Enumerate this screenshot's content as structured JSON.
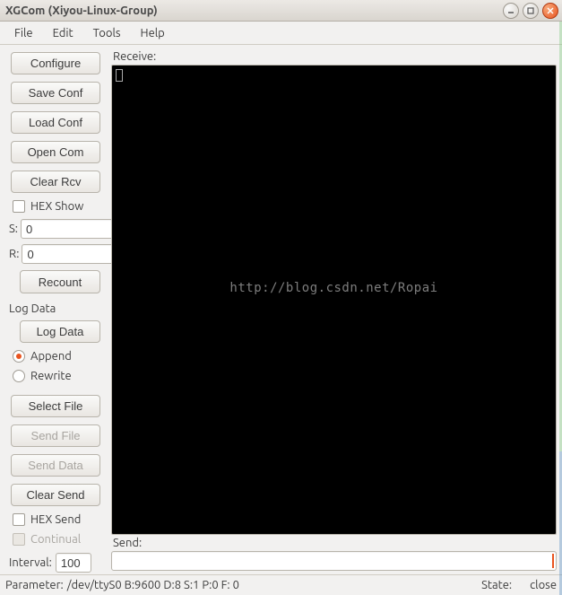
{
  "window": {
    "title": "XGCom (Xiyou-Linux-Group)"
  },
  "menu": {
    "file": "File",
    "edit": "Edit",
    "tools": "Tools",
    "help": "Help"
  },
  "sidebar": {
    "configure": "Configure",
    "save_conf": "Save Conf",
    "load_conf": "Load Conf",
    "open_com": "Open Com",
    "clear_rcv": "Clear Rcv",
    "hex_show": "HEX Show",
    "s_label": "S:",
    "s_value": "0",
    "r_label": "R:",
    "r_value": "0",
    "recount": "Recount",
    "log_data_section": "Log Data",
    "log_data_btn": "Log Data",
    "append": "Append",
    "rewrite": "Rewrite",
    "select_file": "Select File",
    "send_file": "Send File",
    "send_data": "Send Data",
    "clear_send": "Clear Send",
    "hex_send": "HEX Send",
    "continual": "Continual",
    "interval_label": "Interval:",
    "interval_value": "100"
  },
  "main": {
    "receive_label": "Receive:",
    "send_label": "Send:",
    "watermark": "http://blog.csdn.net/Ropai",
    "send_value": ""
  },
  "status": {
    "param_label": "Parameter:",
    "param_value": "/dev/ttyS0 B:9600 D:8 S:1 P:0 F: 0",
    "state_label": "State:",
    "state_value": "close"
  }
}
